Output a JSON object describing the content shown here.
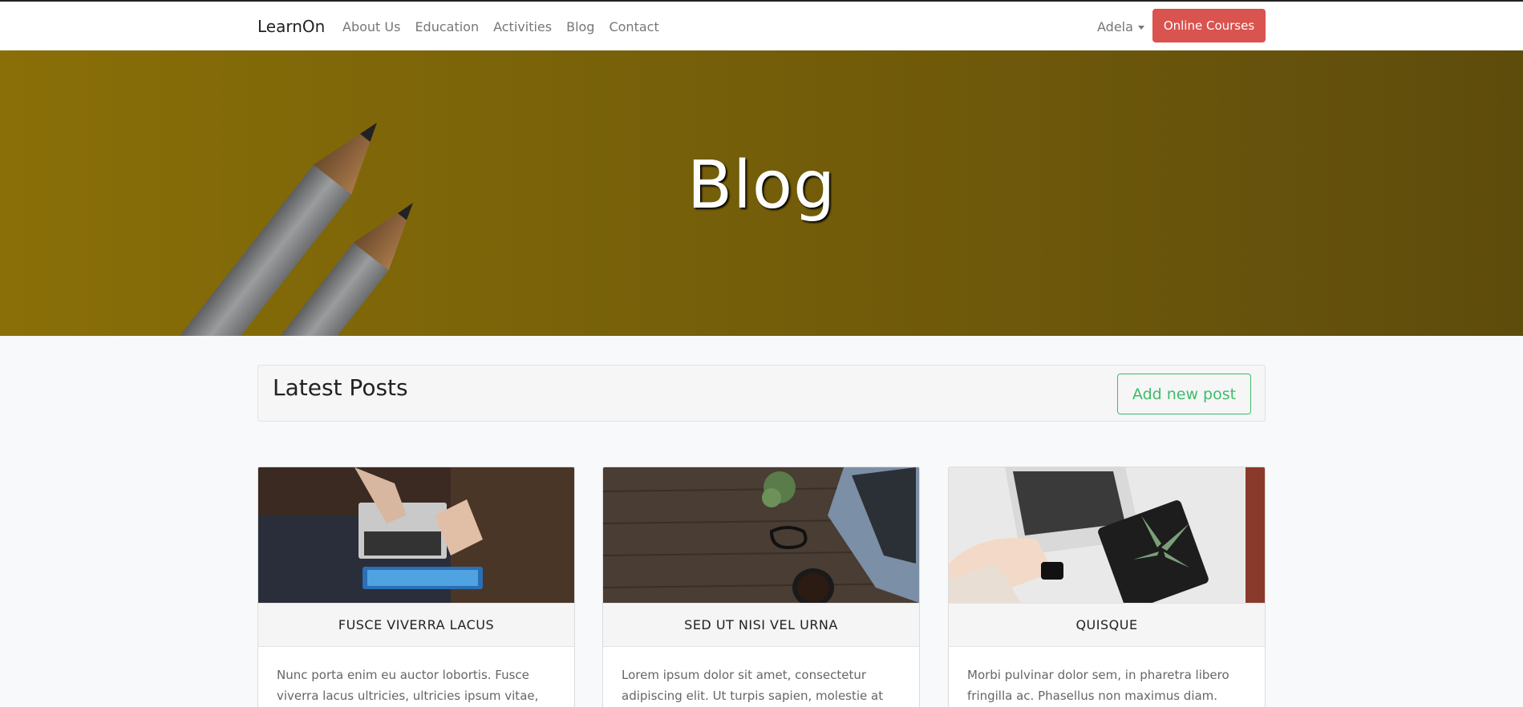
{
  "navbar": {
    "brand": "LearnOn",
    "links": [
      "About Us",
      "Education",
      "Activities",
      "Blog",
      "Contact"
    ],
    "user": "Adela",
    "cta": "Online Courses"
  },
  "hero": {
    "title": "Blog"
  },
  "posts": {
    "heading": "Latest Posts",
    "add_button": "Add new post",
    "cards": [
      {
        "title": "FUSCE VIVERRA LACUS",
        "excerpt": "Nunc porta enim eu auctor lobortis. Fusce viverra lacus ultricies, ultricies ipsum vitae,"
      },
      {
        "title": "SED UT NISI VEL URNA",
        "excerpt": "Lorem ipsum dolor sit amet, consectetur adipiscing elit. Ut turpis sapien, molestie at"
      },
      {
        "title": "QUISQUE",
        "excerpt": "Morbi pulvinar dolor sem, in pharetra libero fringilla ac. Phasellus non maximus diam. Cras"
      }
    ]
  },
  "colors": {
    "cta": "#d9534f",
    "accent_green": "#3dbb6a",
    "hero_bg": "#7a6309"
  }
}
